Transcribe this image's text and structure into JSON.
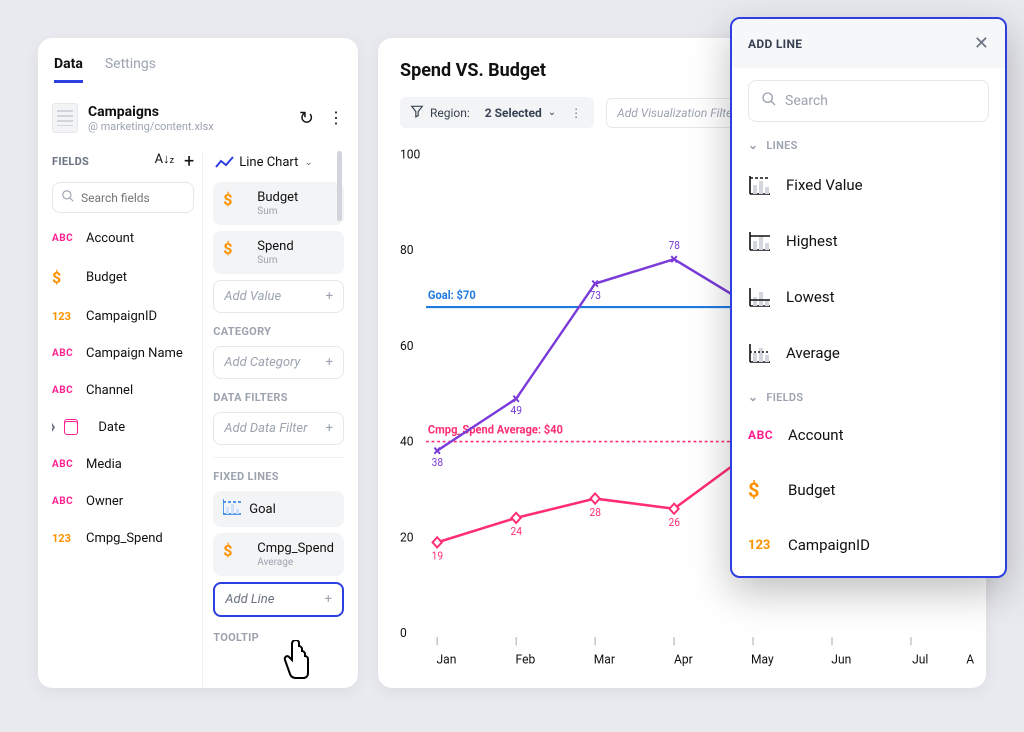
{
  "tabs": {
    "data": "Data",
    "settings": "Settings"
  },
  "datasource": {
    "name": "Campaigns",
    "path": "@ marketing/content.xlsx"
  },
  "fields_label": "FIELDS",
  "search_fields_placeholder": "Search fields",
  "fields": {
    "account": {
      "label": "Account",
      "type": "abc"
    },
    "budget": {
      "label": "Budget",
      "type": "currency"
    },
    "campaign_id": {
      "label": "CampaignID",
      "type": "number"
    },
    "campaign_name": {
      "label": "Campaign Name",
      "type": "abc"
    },
    "channel": {
      "label": "Channel",
      "type": "abc"
    },
    "date": {
      "label": "Date",
      "type": "date",
      "expandable": true
    },
    "media": {
      "label": "Media",
      "type": "abc"
    },
    "owner": {
      "label": "Owner",
      "type": "abc"
    },
    "cmpg_spend": {
      "label": "Cmpg_Spend",
      "type": "number"
    }
  },
  "chart_picker": {
    "label": "Line Chart"
  },
  "config": {
    "measures": {
      "budget": {
        "label": "Budget",
        "agg": "Sum"
      },
      "spend": {
        "label": "Spend",
        "agg": "Sum"
      }
    },
    "add_value": "Add Value",
    "category_title": "CATEGORY",
    "add_category": "Add Category",
    "data_filters_title": "DATA FILTERS",
    "add_data_filter": "Add Data Filter",
    "fixed_lines_title": "FIXED LINES",
    "fixed_lines": {
      "goal": {
        "label": "Goal"
      },
      "avg": {
        "label": "Cmpg_Spend",
        "agg": "Average"
      }
    },
    "add_line": "Add Line",
    "tooltip_title": "TOOLTIP"
  },
  "chart_title": "Spend VS. Budget",
  "filter_chip": {
    "prefix": "Region:",
    "value": "2 Selected"
  },
  "add_viz_filter": "Add Visualization Filter",
  "chart_data": {
    "type": "line",
    "xlabel": "",
    "ylabel": "",
    "categories": [
      "Jan",
      "Feb",
      "Mar",
      "Apr",
      "May",
      "Jun",
      "Jul",
      "Aug"
    ],
    "ylim": [
      0,
      100
    ],
    "y_ticks": [
      0,
      20,
      40,
      60,
      80,
      100
    ],
    "series": [
      {
        "name": "Budget",
        "color": "#7a3bd8",
        "marker": "x",
        "values": [
          38,
          49,
          73,
          78,
          68,
          null,
          null,
          null
        ]
      },
      {
        "name": "Spend",
        "color": "#ff2d73",
        "marker": "diamond",
        "values": [
          19,
          24,
          28,
          26,
          38,
          null,
          null,
          null
        ]
      }
    ],
    "fixed_lines": [
      {
        "label": "Goal: $70",
        "value": 68,
        "color": "#1f7ae0",
        "style": "solid"
      },
      {
        "label": "Cmpg_Spend Average: $40",
        "value": 40,
        "color": "#ff2d73",
        "style": "dashed"
      }
    ],
    "data_labels": {
      "Budget": [
        "38",
        "49",
        "73",
        "78"
      ],
      "Spend": [
        "19",
        "24",
        "28",
        "26"
      ]
    }
  },
  "popover": {
    "title": "ADD LINE",
    "search_placeholder": "Search",
    "group_lines": "LINES",
    "lines": {
      "fixed": "Fixed Value",
      "highest": "Highest",
      "lowest": "Lowest",
      "average": "Average"
    },
    "group_fields": "FIELDS",
    "fields": {
      "account": "Account",
      "budget": "Budget",
      "campaign_id": "CampaignID"
    }
  },
  "colors": {
    "accent": "#2d3fe0",
    "purple": "#7a3bd8",
    "pink": "#ff2d73",
    "blue": "#1f7ae0",
    "orange": "#ff9100",
    "magenta": "#ff1f8f"
  }
}
